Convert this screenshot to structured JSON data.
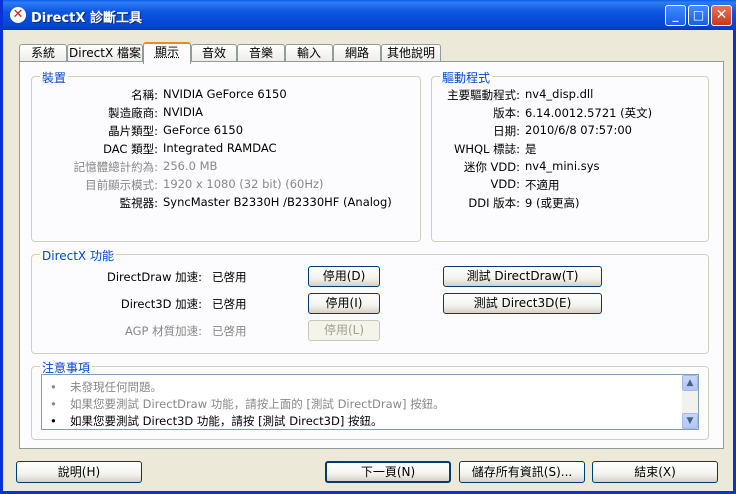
{
  "window": {
    "title": "DirectX 診斷工具",
    "icon": "directx-x-icon",
    "controls": {
      "minimize": "_",
      "maximize": "□",
      "close": "✕"
    }
  },
  "tabs": [
    {
      "label": "系統",
      "active": false
    },
    {
      "label": "DirectX 檔案",
      "active": false
    },
    {
      "label": "顯示",
      "active": true
    },
    {
      "label": "音效",
      "active": false
    },
    {
      "label": "音樂",
      "active": false
    },
    {
      "label": "輸入",
      "active": false
    },
    {
      "label": "網路",
      "active": false
    },
    {
      "label": "其他說明",
      "active": false
    }
  ],
  "device": {
    "title": "裝置",
    "rows": [
      {
        "label": "名稱:",
        "value": "NVIDIA GeForce 6150",
        "gray": false
      },
      {
        "label": "製造廠商:",
        "value": "NVIDIA",
        "gray": false
      },
      {
        "label": "晶片類型:",
        "value": "GeForce 6150",
        "gray": false
      },
      {
        "label": "DAC 類型:",
        "value": "Integrated RAMDAC",
        "gray": false
      },
      {
        "label": "記憶體總計約為:",
        "value": "256.0 MB",
        "gray": true
      },
      {
        "label": "目前顯示模式:",
        "value": "1920 x 1080 (32 bit) (60Hz)",
        "gray": true
      },
      {
        "label": "監視器:",
        "value": "SyncMaster B2330H /B2330HF (Analog)",
        "gray": false
      }
    ]
  },
  "driver": {
    "title": "驅動程式",
    "rows": [
      {
        "label": "主要驅動程式:",
        "value": "nv4_disp.dll"
      },
      {
        "label": "版本:",
        "value": "6.14.0012.5721 (英文)"
      },
      {
        "label": "日期:",
        "value": "2010/6/8 07:57:00"
      },
      {
        "label": "WHQL 標誌:",
        "value": "是"
      },
      {
        "label": "迷你 VDD:",
        "value": "nv4_mini.sys"
      },
      {
        "label": "VDD:",
        "value": "不適用"
      },
      {
        "label": "DDI 版本:",
        "value": "9 (或更高)"
      }
    ]
  },
  "features": {
    "title": "DirectX 功能",
    "rows": [
      {
        "label": "DirectDraw 加速:",
        "status": "已啓用",
        "disable_btn": "停用(D)",
        "test_btn": "測試 DirectDraw(T)",
        "disabled": false
      },
      {
        "label": "Direct3D 加速:",
        "status": "已啓用",
        "disable_btn": "停用(I)",
        "test_btn": "測試 Direct3D(E)",
        "disabled": false
      },
      {
        "label": "AGP 材質加速:",
        "status": "已啓用",
        "disable_btn": "停用(L)",
        "test_btn": "",
        "disabled": true
      }
    ]
  },
  "notes": {
    "title": "注意事項",
    "lines": [
      {
        "text": "未發現任何問題。",
        "gray": true
      },
      {
        "text": "如果您要測試 DirectDraw 功能，請按上面的 [測試 DirectDraw] 按鈕。",
        "gray": true
      },
      {
        "text": "如果您要測試 Direct3D 功能，請按 [測試 Direct3D] 按鈕。",
        "gray": false
      }
    ]
  },
  "buttons": {
    "help": "說明(H)",
    "next": "下一頁(N)",
    "save": "儲存所有資訊(S)...",
    "exit": "結束(X)"
  }
}
